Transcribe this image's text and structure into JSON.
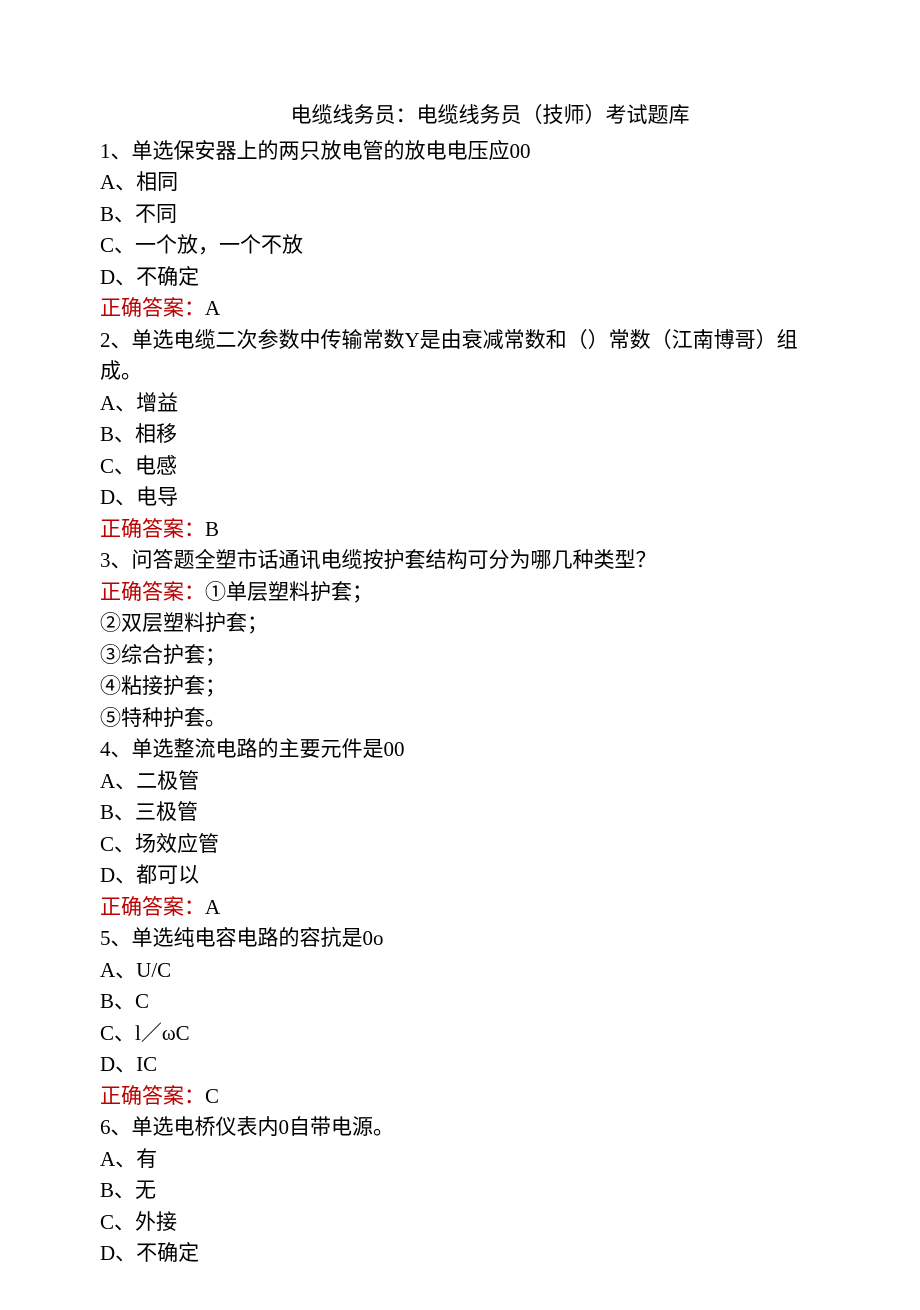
{
  "title": "电缆线务员：电缆线务员（技师）考试题库",
  "q1": {
    "stem": "1、单选保安器上的两只放电管的放电电压应00",
    "a": "A、相同",
    "b": "B、不同",
    "c": "C、一个放，一个不放",
    "d": "D、不确定",
    "ans_label": "正确答案：",
    "ans_value": "A"
  },
  "q2": {
    "stem1": "2、单选电缆二次参数中传输常数Y是由衰减常数和（）常数（江南博哥）组",
    "stem2": "成。",
    "a": "A、增益",
    "b": "B、相移",
    "c": "C、电感",
    "d": "D、电导",
    "ans_label": "正确答案：",
    "ans_value": "B"
  },
  "q3": {
    "stem": "3、问答题全塑市话通讯电缆按护套结构可分为哪几种类型？",
    "ans_label": "正确答案：",
    "ans_first": "①单层塑料护套；",
    "l2": "②双层塑料护套；",
    "l3": "③综合护套；",
    "l4": "④粘接护套；",
    "l5": "⑤特种护套。"
  },
  "q4": {
    "stem": "4、单选整流电路的主要元件是00",
    "a": "A、二极管",
    "b": "B、三极管",
    "c": "C、场效应管",
    "d": "D、都可以",
    "ans_label": "正确答案：",
    "ans_value": "A"
  },
  "q5": {
    "stem": "5、单选纯电容电路的容抗是0o",
    "a": "A、U/C",
    "b": "B、C",
    "c": "C、l／ωC",
    "d": "D、IC",
    "ans_label": "正确答案：",
    "ans_value": "C"
  },
  "q6": {
    "stem": "6、单选电桥仪表内0自带电源。",
    "a": "A、有",
    "b": "B、无",
    "c": "C、外接",
    "d": "D、不确定"
  }
}
